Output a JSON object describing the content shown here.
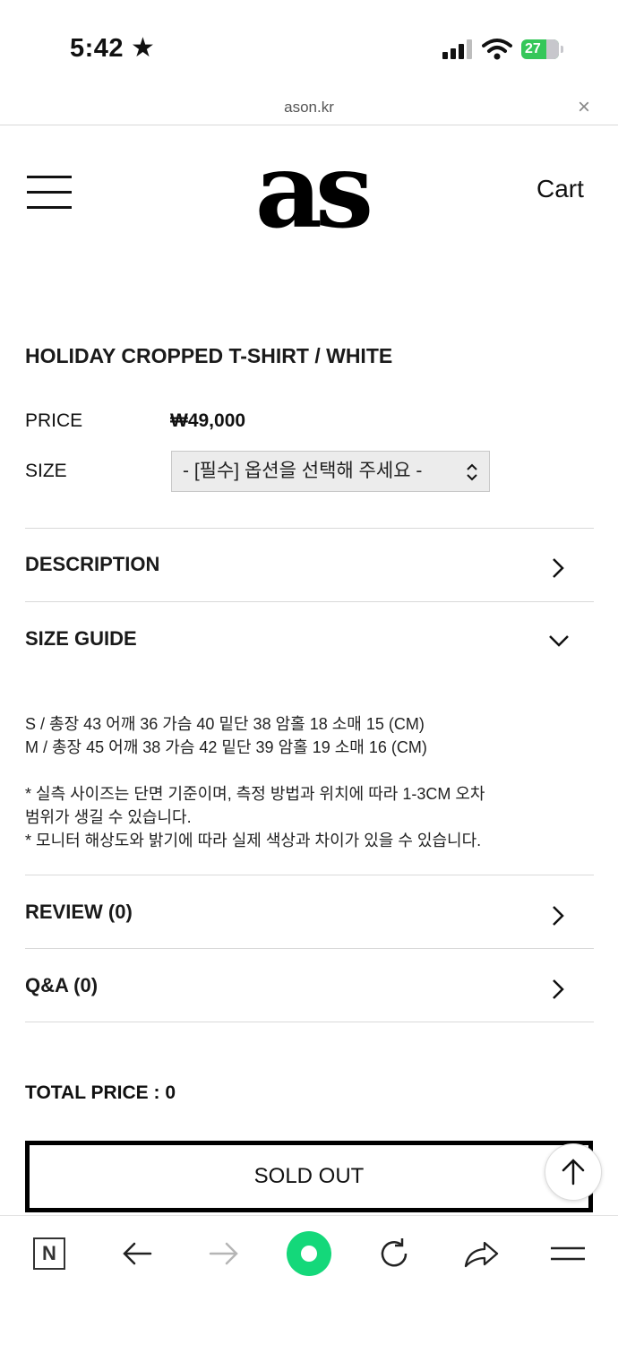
{
  "status_bar": {
    "time": "5:42",
    "star": "★",
    "battery": "27"
  },
  "browser": {
    "url": "ason.kr",
    "close": "×"
  },
  "header": {
    "logo": "as",
    "cart": "Cart"
  },
  "product": {
    "title": "HOLIDAY CROPPED T-SHIRT / WHITE",
    "price_label": "PRICE",
    "price": "₩49,000",
    "size_label": "SIZE",
    "size_select": "- [필수] 옵션을 선택해 주세요 -"
  },
  "sections": {
    "description": "DESCRIPTION",
    "size_guide": "SIZE GUIDE",
    "review": "REVIEW (0)",
    "qa": "Q&A (0)"
  },
  "size_guide": {
    "line_s": "S / 총장 43 어깨 36 가슴 40 밑단 38 암홀 18 소매 15 (CM)",
    "line_m": "M / 총장 45 어깨 38 가슴 42 밑단 39 암홀 19 소매 16 (CM)",
    "note1a": "* 실측 사이즈는 단면 기준이며, 측정 방법과 위치에 따라 1-3CM 오차",
    "note1b": "범위가 생길 수 있습니다.",
    "note2": "* 모니터 해상도와 밝기에 따라 실제 색상과 차이가 있을 수 있습니다."
  },
  "purchase": {
    "total": "TOTAL PRICE : 0",
    "sold_out": "SOLD OUT"
  },
  "toolbar": {
    "n_logo": "N"
  }
}
